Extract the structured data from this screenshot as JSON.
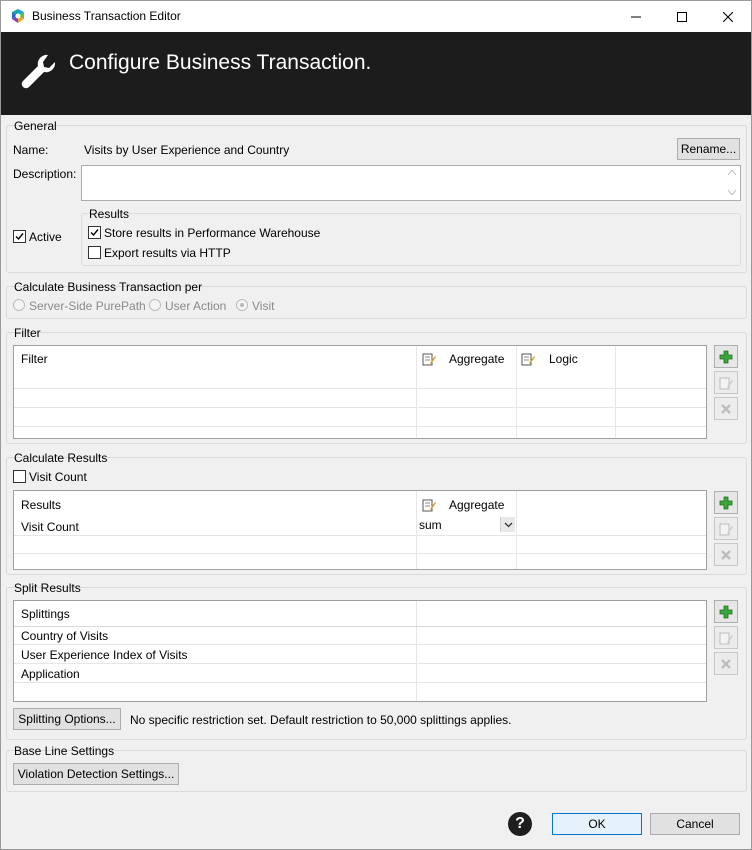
{
  "window": {
    "title": "Business Transaction Editor",
    "banner_title": "Configure Business Transaction."
  },
  "general": {
    "group_title": "General",
    "name_label": "Name:",
    "name_value": "Visits by User Experience and Country",
    "rename_button": "Rename...",
    "description_label": "Description:",
    "description_value": "",
    "active_label": "Active",
    "active_checked": true,
    "results": {
      "group_title": "Results",
      "store_label": "Store results in Performance Warehouse",
      "store_checked": true,
      "export_label": "Export results via HTTP",
      "export_checked": false
    }
  },
  "calc_per": {
    "group_title": "Calculate Business Transaction per",
    "options": [
      {
        "label": "Server-Side PurePath",
        "selected": false
      },
      {
        "label": "User Action",
        "selected": false
      },
      {
        "label": "Visit",
        "selected": true
      }
    ]
  },
  "filter": {
    "group_title": "Filter",
    "columns": [
      "Filter",
      "Aggregate",
      "Logic"
    ]
  },
  "calc_results": {
    "group_title": "Calculate Results",
    "visit_count_label": "Visit Count",
    "visit_count_checked": false,
    "columns": [
      "Results",
      "Aggregate"
    ],
    "rows": [
      {
        "result": "Visit Count",
        "aggregate": "sum"
      }
    ]
  },
  "split_results": {
    "group_title": "Split Results",
    "column": "Splittings",
    "rows": [
      "Country of Visits",
      "User Experience Index of Visits",
      "Application"
    ],
    "options_button": "Splitting Options...",
    "restriction_text": "No specific restriction set. Default restriction to 50,000 splittings applies."
  },
  "baseline": {
    "group_title": "Base Line Settings",
    "violation_button": "Violation Detection Settings..."
  },
  "footer": {
    "ok_button": "OK",
    "cancel_button": "Cancel"
  },
  "icons": {
    "app": "dynatrace-app-icon",
    "banner": "wrench-icon",
    "add": "add-icon",
    "edit": "edit-icon",
    "delete": "delete-icon",
    "help": "help-icon"
  },
  "colors": {
    "banner_bg": "#1c1c1c",
    "add_green": "#2e9e2e",
    "ok_border": "#0078d7"
  }
}
